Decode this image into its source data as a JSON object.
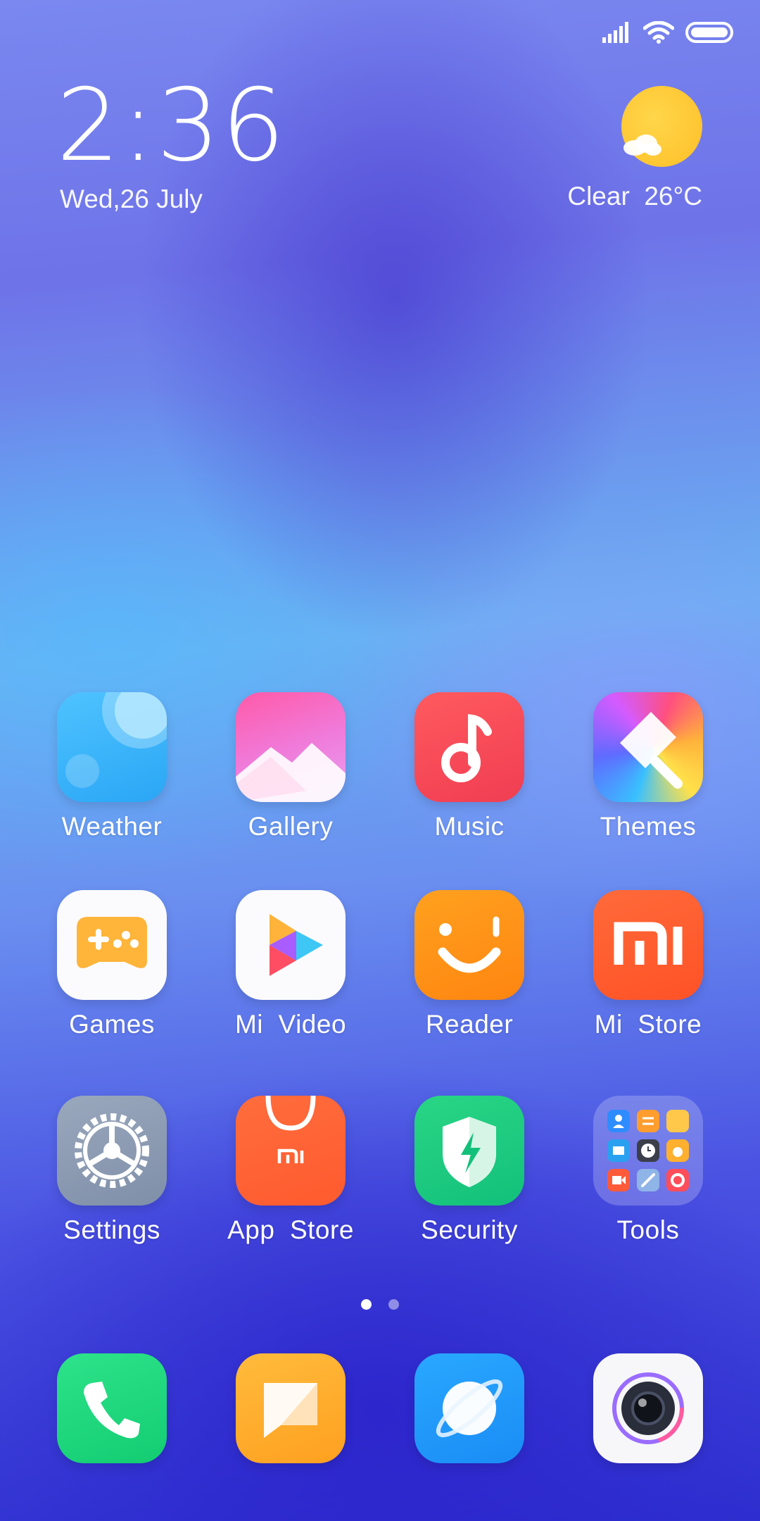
{
  "clock": {
    "time": "2:36",
    "date": "Wed,26 July"
  },
  "weather": {
    "text": "Clear  26°C",
    "condition_icon": "sun-cloud-icon"
  },
  "status": {
    "icons": [
      "signal-icon",
      "wifi-icon",
      "battery-icon"
    ]
  },
  "apps": [
    {
      "label": "Weather"
    },
    {
      "label": "Gallery"
    },
    {
      "label": "Music"
    },
    {
      "label": "Themes"
    },
    {
      "label": "Games"
    },
    {
      "label": "Mi  Video"
    },
    {
      "label": "Reader"
    },
    {
      "label": "Mi  Store"
    },
    {
      "label": "Settings"
    },
    {
      "label": "App  Store"
    },
    {
      "label": "Security"
    },
    {
      "label": "Tools"
    }
  ],
  "dock": [
    "phone-icon",
    "messages-icon",
    "browser-icon",
    "camera-icon"
  ],
  "pages": {
    "count": 2,
    "current": 1
  }
}
